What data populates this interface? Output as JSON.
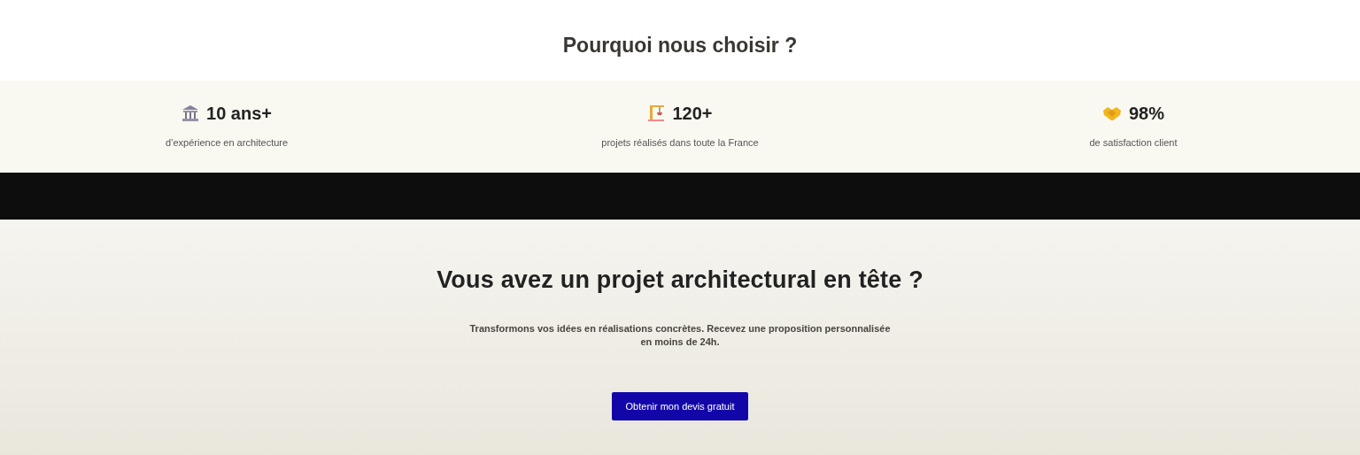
{
  "heading": "Pourquoi nous choisir ?",
  "stats": [
    {
      "value": "10 ans+",
      "caption": "d’expérience en architecture"
    },
    {
      "value": "120+",
      "caption": "projets réalisés dans toute la France"
    },
    {
      "value": "98%",
      "caption": "de satisfaction client"
    }
  ],
  "cta": {
    "title": "Vous avez un projet architectural en tête ?",
    "text": "Transformons vos idées en réalisations concrètes. Recevez une proposition personnalisée en moins de 24h.",
    "button": "Obtenir mon devis gratuit"
  }
}
